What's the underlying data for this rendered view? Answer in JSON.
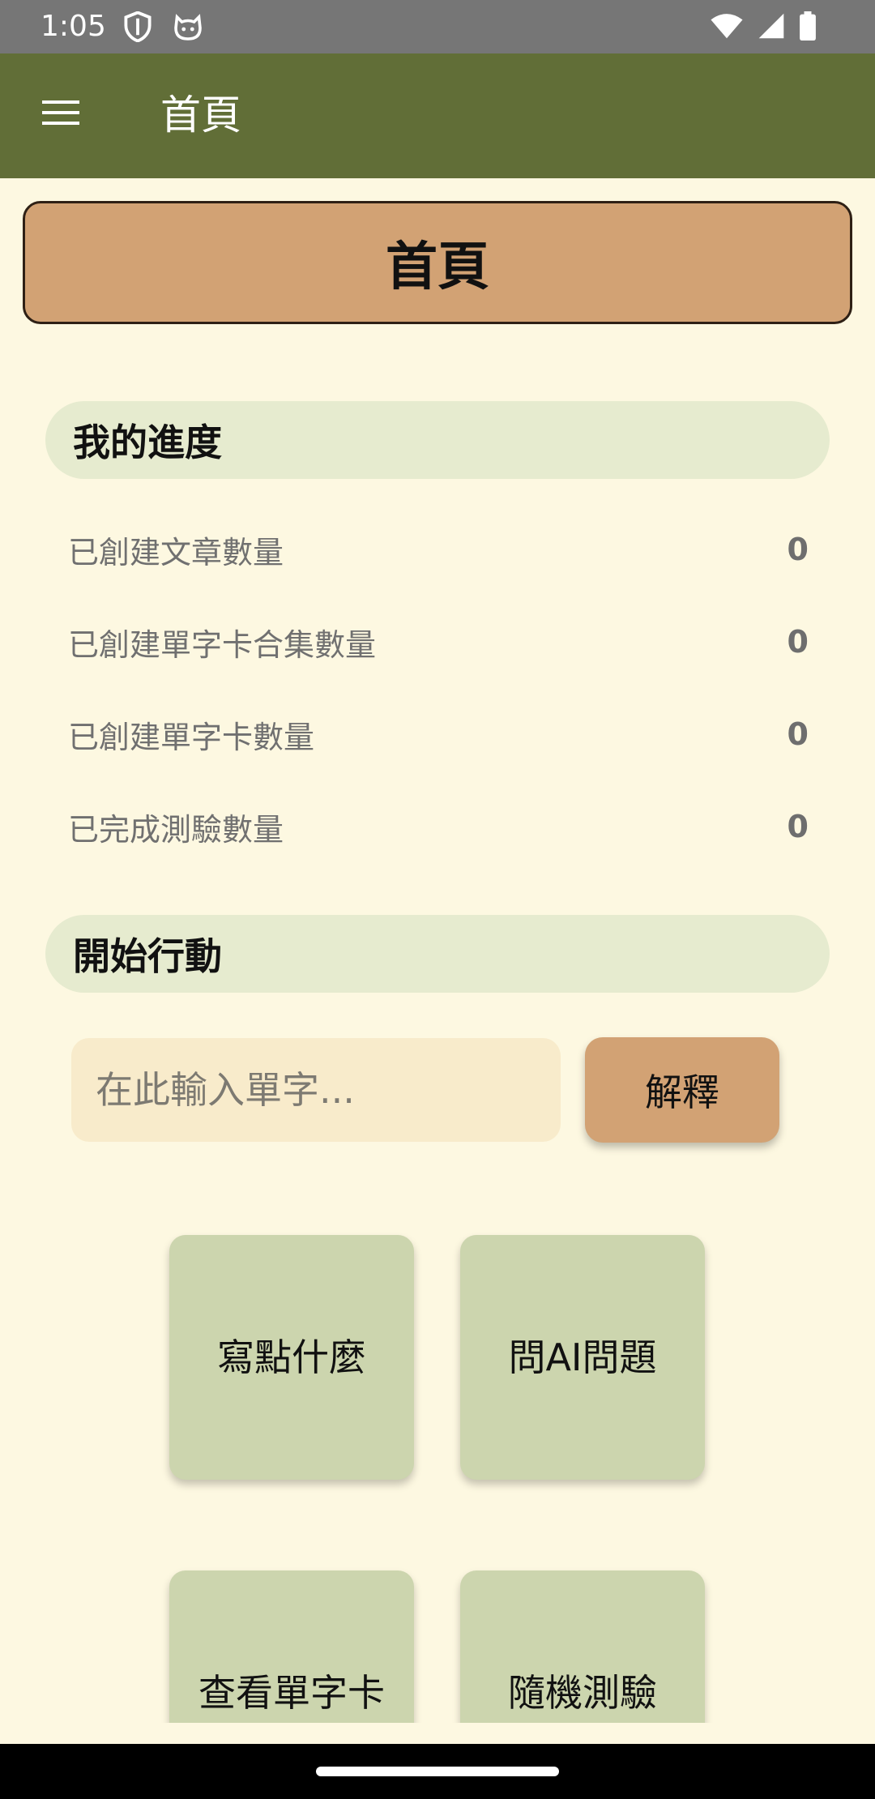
{
  "status_bar": {
    "time": "1:05",
    "icons": [
      "shield-icon",
      "cat-icon",
      "wifi-icon",
      "signal-icon",
      "battery-icon"
    ]
  },
  "app_bar": {
    "title": "首頁",
    "menu_icon": "menu-icon"
  },
  "header": {
    "title": "首頁"
  },
  "progress": {
    "title": "我的進度",
    "stats": [
      {
        "label": "已創建文章數量",
        "value": "0"
      },
      {
        "label": "已創建單字卡合集數量",
        "value": "0"
      },
      {
        "label": "已創建單字卡數量",
        "value": "0"
      },
      {
        "label": "已完成測驗數量",
        "value": "0"
      }
    ]
  },
  "actions": {
    "title": "開始行動",
    "input_placeholder": "在此輸入單字...",
    "explain_label": "解釋",
    "tiles": [
      {
        "label": "寫點什麼"
      },
      {
        "label": "問AI問題"
      },
      {
        "label": "查看單字卡"
      },
      {
        "label": "隨機測驗"
      }
    ]
  },
  "colors": {
    "app_bar": "#616E37",
    "background": "#FDF8E1",
    "banner": "#D2A274",
    "section_header": "#E6EBCF",
    "tile": "#CCD5AE",
    "input": "#F8EBCB"
  }
}
